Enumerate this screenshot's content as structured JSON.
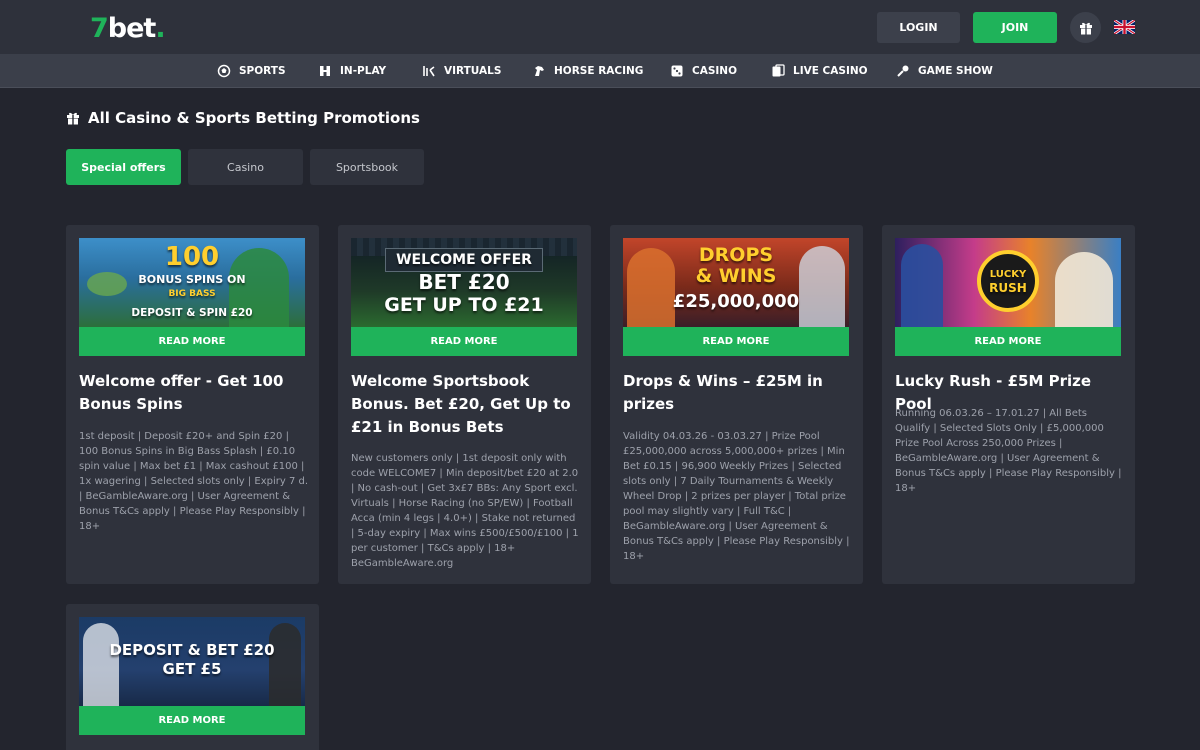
{
  "header": {
    "logo": {
      "seven": "7",
      "bet": "bet",
      "dot": "."
    },
    "login_label": "LOGIN",
    "join_label": "JOIN"
  },
  "nav": [
    {
      "label": "SPORTS",
      "icon": "football-icon"
    },
    {
      "label": "IN-PLAY",
      "icon": "in-play-icon"
    },
    {
      "label": "VIRTUALS",
      "icon": "virtuals-icon"
    },
    {
      "label": "HORSE RACING",
      "icon": "horse-icon"
    },
    {
      "label": "CASINO",
      "icon": "dice-icon"
    },
    {
      "label": "LIVE CASINO",
      "icon": "cards-icon"
    },
    {
      "label": "GAME SHOW",
      "icon": "microphone-icon"
    }
  ],
  "page": {
    "title": "All Casino & Sports Betting Promotions"
  },
  "tabs": [
    {
      "label": "Special offers",
      "active": true
    },
    {
      "label": "Casino",
      "active": false
    },
    {
      "label": "Sportsbook",
      "active": false
    }
  ],
  "promos": [
    {
      "banner_lines": [
        "100",
        "BONUS SPINS ON",
        "BIG BASS",
        "DEPOSIT & SPIN £20"
      ],
      "read_more": "READ MORE",
      "title": "Welcome offer - Get 100 Bonus Spins",
      "desc": "1st deposit | Deposit £20+ and Spin £20 | 100 Bonus Spins in Big Bass Splash | £0.10 spin value | Max bet £1 | Max cashout £100 | 1x wagering | Selected slots only | Expiry 7 d. | BeGambleAware.org | User Agreement & Bonus T&Cs apply | Please Play Responsibly | 18+"
    },
    {
      "banner_lines": [
        "WELCOME OFFER",
        "BET £20",
        "GET UP TO £21"
      ],
      "read_more": "READ MORE",
      "title": "Welcome Sportsbook Bonus. Bet £20, Get Up to £21 in Bonus Bets",
      "desc": "New customers only | 1st deposit only with code WELCOME7 | Min deposit/bet £20 at 2.0 | No cash-out | Get 3x£7 BBs: Any Sport excl. Virtuals | Horse Racing (no SP/EW) | Football Acca (min 4 legs | 4.0+) | Stake not returned | 5-day expiry | Max wins £500/£500/£100 | 1 per customer | T&Cs apply | 18+ BeGambleAware.org"
    },
    {
      "banner_lines": [
        "DROPS",
        "& WINS",
        "£25,000,000"
      ],
      "read_more": "READ MORE",
      "title": "Drops & Wins – £25M in prizes",
      "desc": "Validity 04.03.26 - 03.03.27 | Prize Pool £25,000,000 across 5,000,000+ prizes | Min Bet £0.15 | 96,900 Weekly Prizes | Selected slots only | 7 Daily Tournaments & Weekly Wheel Drop | 2 prizes per player | Total prize pool may slightly vary | Full T&C | BeGambleAware.org | User Agreement & Bonus T&Cs apply | Please Play Responsibly | 18+"
    },
    {
      "banner_lines": [
        "LUCKY",
        "RUSH"
      ],
      "read_more": "READ MORE",
      "title": "Lucky Rush - £5M Prize Pool",
      "desc": "Running 06.03.26 – 17.01.27 | All Bets Qualify | Selected Slots Only | £5,000,000 Prize Pool Across 250,000 Prizes | BeGambleAware.org | User Agreement & Bonus T&Cs apply | Please Play Responsibly | 18+"
    },
    {
      "banner_lines": [
        "DEPOSIT & BET £20",
        "GET £5"
      ],
      "read_more": "READ MORE"
    }
  ],
  "colors": {
    "accent": "#1fb35a",
    "background": "#23252e",
    "card": "#2f323c",
    "header": "#2e313b",
    "nav": "#3b3f4a"
  }
}
